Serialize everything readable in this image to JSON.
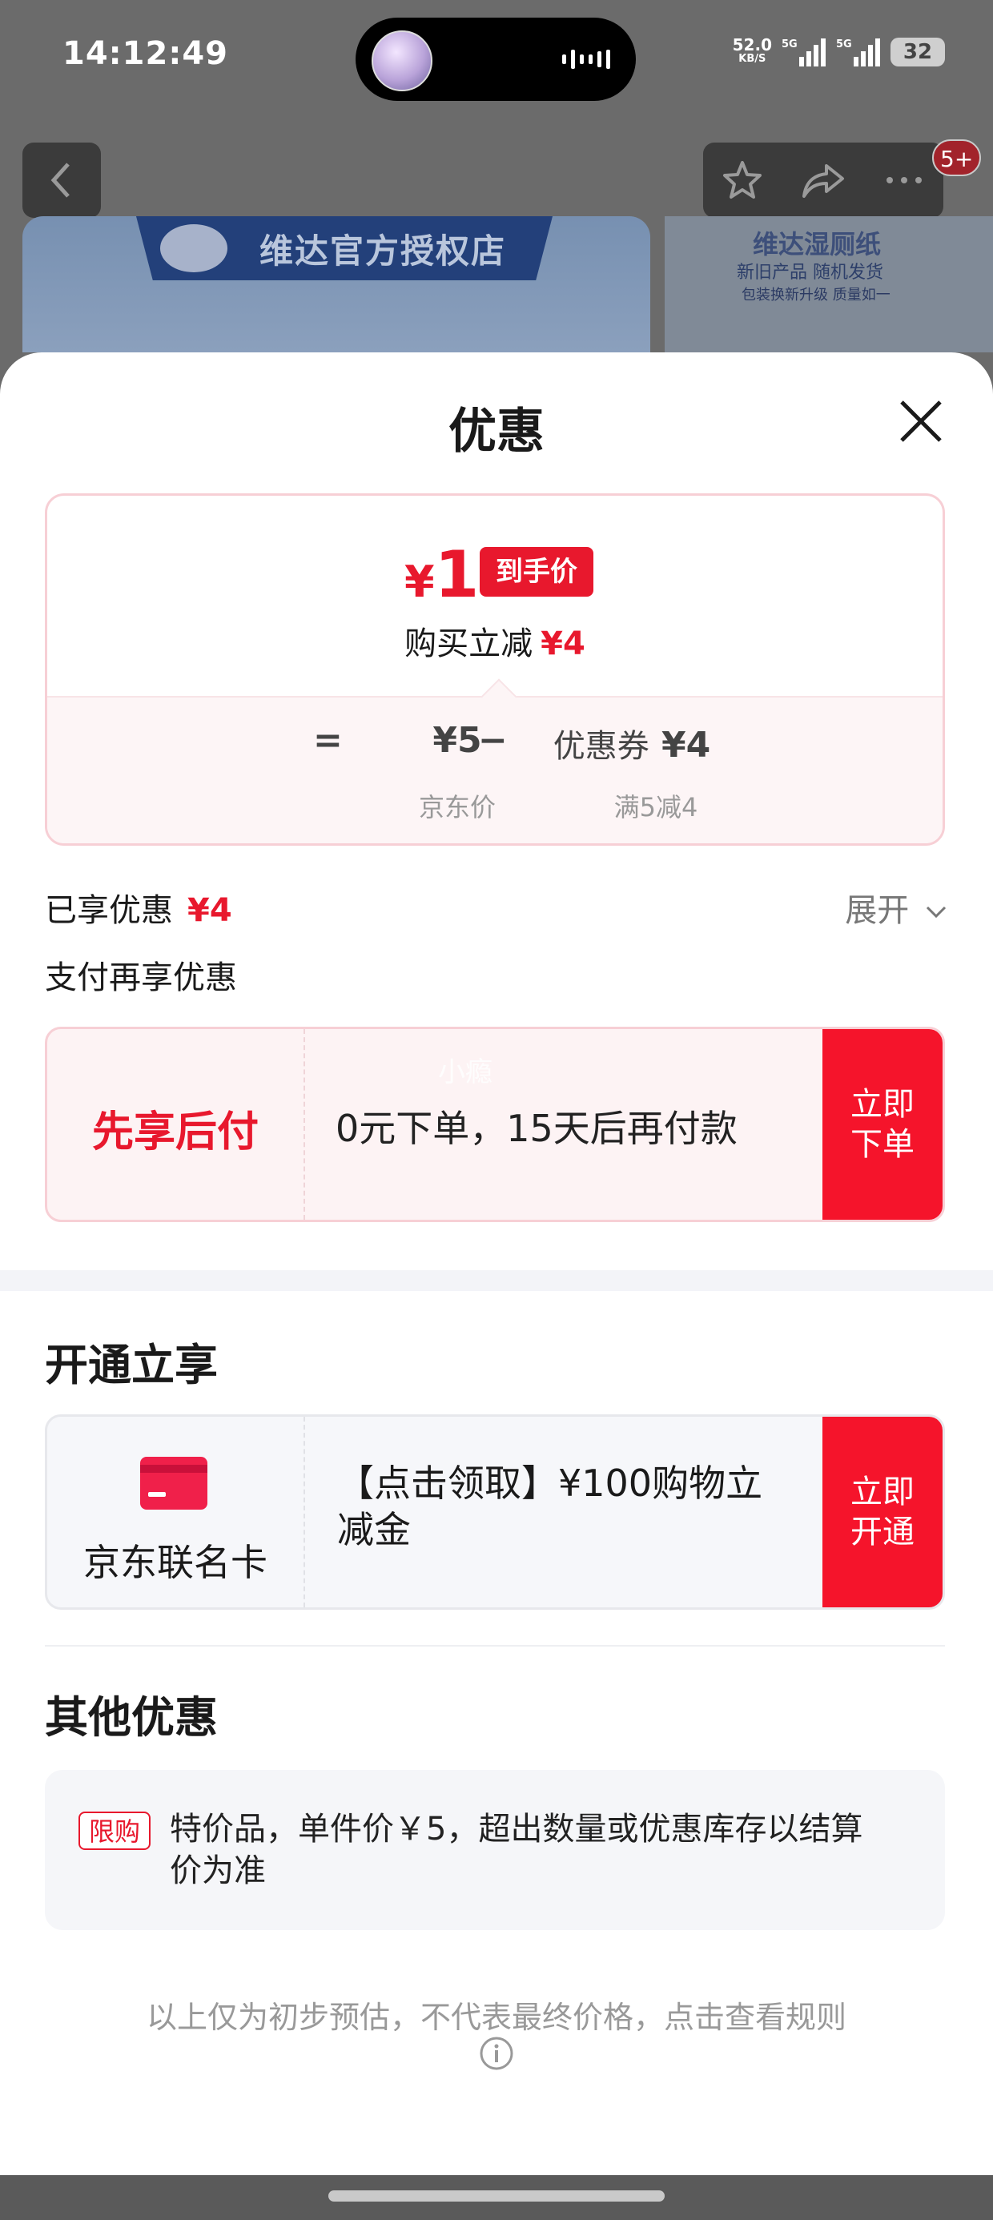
{
  "status_bar": {
    "time": "14:12:49",
    "speed": "52.0",
    "speed_unit": "KB/S",
    "net1": "5G",
    "net2": "5G",
    "battery": "32"
  },
  "nav": {
    "back_icon": "chevron-left-icon",
    "badge": "5+",
    "icons": [
      "star-icon",
      "share-icon",
      "more-icon"
    ]
  },
  "background": {
    "store_name": "维达官方授权店",
    "promo_title": "维达湿厕纸",
    "promo_sub": "新旧产品 随机发货",
    "promo_sub2": "包装换新升级 质量如一"
  },
  "sheet": {
    "title": "优惠",
    "price_card": {
      "final_currency": "¥",
      "final_value": "1",
      "final_tag": "到手价",
      "reduce_label": "购买立减",
      "reduce_amount": "¥4",
      "eq": "=",
      "orig_price": "¥5",
      "minus": "−",
      "coupon_label": "优惠券",
      "coupon_amount": "¥4",
      "orig_label": "京东价",
      "coupon_rule": "满5减4"
    },
    "enjoyed_label": "已享优惠",
    "enjoyed_amount": "¥4",
    "expand_label": "展开",
    "pay_more_label": "支付再享优惠",
    "bnpl": {
      "name": "先享后付",
      "desc": "0元下单，15天后再付款",
      "watermark": "小瘾",
      "cta": "立即\n下单"
    },
    "open_section_title": "开通立享",
    "card_offer": {
      "name": "京东联名卡",
      "desc": "【点击领取】¥100购物立减金",
      "cta": "立即\n开通"
    },
    "other_section_title": "其他优惠",
    "other_offer": {
      "tag": "限购",
      "text": "特价品，单件价￥5，超出数量或优惠库存以结算价为准"
    },
    "disclaimer": "以上仅为初步预估，不代表最终价格，点击查看规则",
    "colors": {
      "accent": "#e8182d",
      "cta": "#f5142b"
    }
  }
}
